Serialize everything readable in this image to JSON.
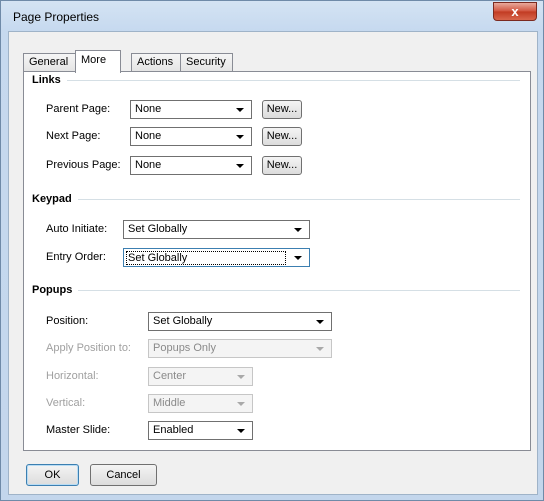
{
  "window": {
    "title": "Page Properties",
    "close_glyph": "x"
  },
  "tabs": [
    {
      "label": "General"
    },
    {
      "label": "More"
    },
    {
      "label": "Actions"
    },
    {
      "label": "Security"
    }
  ],
  "active_tab": "More",
  "links": {
    "heading": "Links",
    "parent_page": {
      "label": "Parent Page:",
      "value": "None",
      "new_label": "New..."
    },
    "next_page": {
      "label": "Next Page:",
      "value": "None",
      "new_label": "New..."
    },
    "previous_page": {
      "label": "Previous Page:",
      "value": "None",
      "new_label": "New..."
    }
  },
  "keypad": {
    "heading": "Keypad",
    "auto_initiate": {
      "label": "Auto Initiate:",
      "value": "Set Globally"
    },
    "entry_order": {
      "label": "Entry Order:",
      "value": "Set Globally"
    }
  },
  "popups": {
    "heading": "Popups",
    "position": {
      "label": "Position:",
      "value": "Set Globally"
    },
    "apply_position_to": {
      "label": "Apply Position to:",
      "value": "Popups Only"
    },
    "horizontal": {
      "label": "Horizontal:",
      "value": "Center"
    },
    "vertical": {
      "label": "Vertical:",
      "value": "Middle"
    },
    "master_slide": {
      "label": "Master Slide:",
      "value": "Enabled"
    }
  },
  "footer": {
    "ok_label": "OK",
    "cancel_label": "Cancel"
  },
  "colors": {
    "close_button": "#c13a22",
    "focus_border": "#3c7fb1",
    "disabled_text": "#a0a0a0"
  }
}
